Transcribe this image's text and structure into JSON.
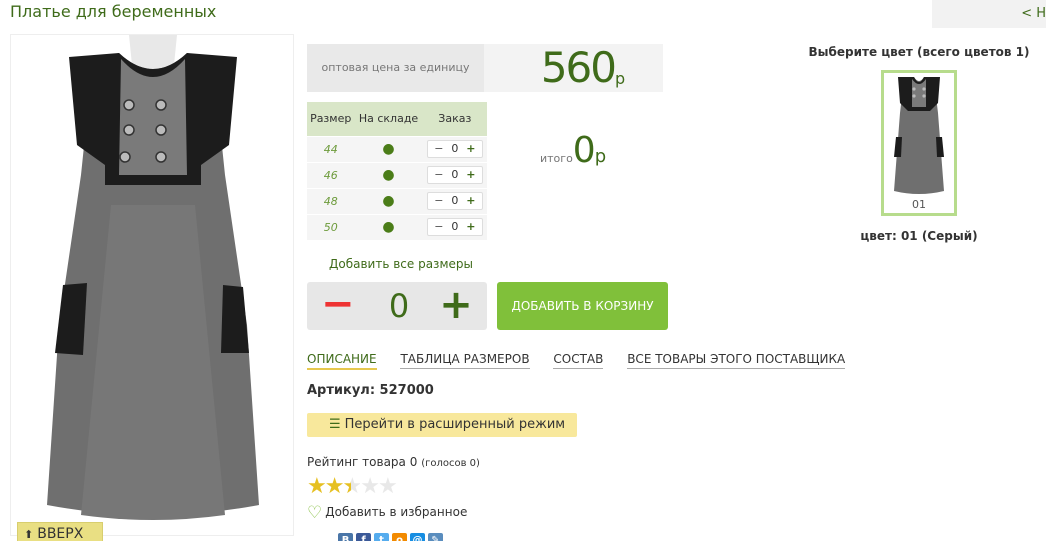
{
  "product": {
    "title": "Платье для беременных",
    "nav_back": "< Н"
  },
  "price": {
    "label": "оптовая цена за единицу",
    "value": "560",
    "currency": "р"
  },
  "sizes": {
    "headers": [
      "Размер",
      "На складе",
      "Заказ"
    ],
    "rows": [
      {
        "size": "44",
        "stock": "●",
        "qty": "0"
      },
      {
        "size": "46",
        "stock": "●",
        "qty": "0"
      },
      {
        "size": "48",
        "stock": "●",
        "qty": "0"
      },
      {
        "size": "50",
        "stock": "●",
        "qty": "0"
      }
    ]
  },
  "total": {
    "label": "итого",
    "value": "0",
    "currency": "р"
  },
  "actions": {
    "add_all_sizes": "Добавить все размеры",
    "quantity": "0",
    "minus": "−",
    "plus": "+",
    "add_to_cart": "ДОБАВИТЬ В КОРЗИНУ",
    "advanced_mode": "Перейти в расширенный режим",
    "up": "ВВЕРХ"
  },
  "tabs": [
    "ОПИСАНИЕ",
    "ТАБЛИЦА РАЗМЕРОВ",
    "СОСТАВ",
    "ВСЕ ТОВАРЫ ЭТОГО ПОСТАВЩИКА"
  ],
  "article": "Артикул: 527000",
  "rating": {
    "label": "Рейтинг товара",
    "value": "0",
    "votes": "(голосов 0)",
    "stars_filled": 2.5,
    "stars_total": 5
  },
  "favorites": "Добавить в избранное",
  "colors": {
    "title": "Выберите цвет (всего цветов 1)",
    "items": [
      {
        "code": "01"
      }
    ],
    "caption": "цвет: 01 (Серый)"
  },
  "social": [
    {
      "name": "vk-icon",
      "glyph": "B",
      "color": "#4a76a8"
    },
    {
      "name": "facebook-icon",
      "glyph": "f",
      "color": "#3b5998"
    },
    {
      "name": "twitter-icon",
      "glyph": "t",
      "color": "#55acee"
    },
    {
      "name": "odnoklassniki-icon",
      "glyph": "о",
      "color": "#f28a00"
    },
    {
      "name": "mailru-icon",
      "glyph": "@",
      "color": "#168de2"
    },
    {
      "name": "livejournal-icon",
      "glyph": "✎",
      "color": "#5a8dbe"
    }
  ],
  "theme": {
    "accent": "#3f6b1a",
    "cart_button": "#80c03a"
  }
}
